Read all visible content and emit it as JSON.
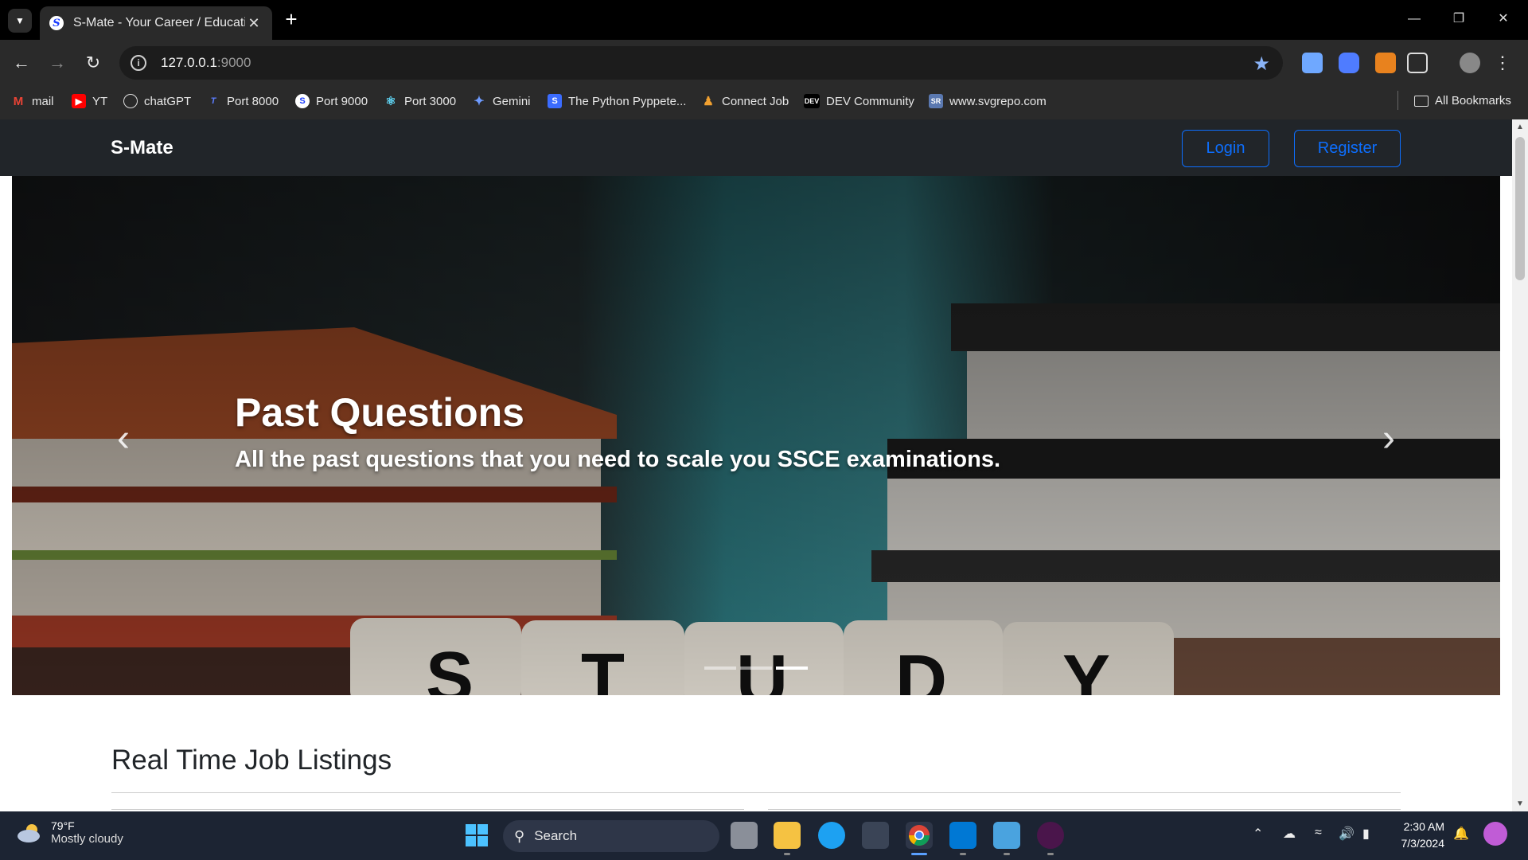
{
  "browser": {
    "tab_title": "S-Mate - Your Career / Educatio",
    "url_host": "127.0.0.1",
    "url_port": ":9000",
    "bookmarks": [
      {
        "label": "mail",
        "icon": "gmail-icon"
      },
      {
        "label": "YT",
        "icon": "youtube-icon"
      },
      {
        "label": "chatGPT",
        "icon": "chatgpt-icon"
      },
      {
        "label": "Port 8000",
        "icon": "port-icon"
      },
      {
        "label": "Port 9000",
        "icon": "port-icon"
      },
      {
        "label": "Port 3000",
        "icon": "react-icon"
      },
      {
        "label": "Gemini",
        "icon": "gemini-icon"
      },
      {
        "label": "The Python Pyppete...",
        "icon": "bookmark-icon"
      },
      {
        "label": "Connect Job",
        "icon": "people-icon"
      },
      {
        "label": "DEV Community",
        "icon": "dev-icon"
      },
      {
        "label": "www.svgrepo.com",
        "icon": "svgrepo-icon"
      }
    ],
    "all_bookmarks": "All Bookmarks"
  },
  "site": {
    "brand": "S-Mate",
    "login": "Login",
    "register": "Register",
    "carousel": {
      "title": "Past Questions",
      "subtitle": "All the past questions that you need to scale you SSCE examinations.",
      "active_slide": 3,
      "slide_count": 3
    },
    "section_title": "Real Time Job Listings"
  },
  "taskbar": {
    "temp": "79°F",
    "weather": "Mostly cloudy",
    "search": "Search",
    "time": "2:30 AM",
    "date": "7/3/2024"
  },
  "colors": {
    "accent": "#0d6efd",
    "navbar": "#212529",
    "taskbar": "#1c2433"
  }
}
